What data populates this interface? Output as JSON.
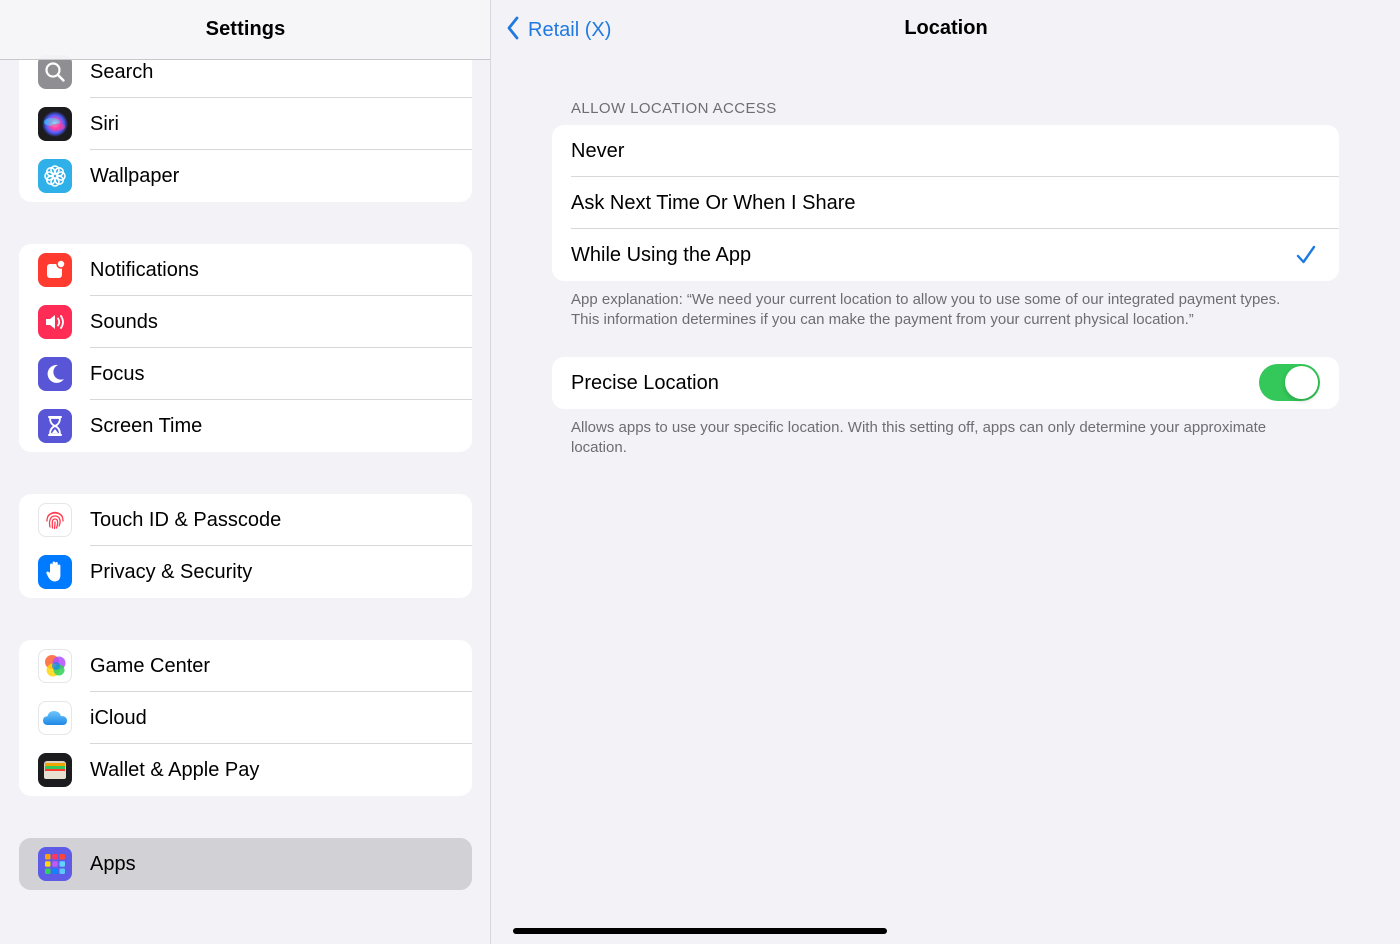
{
  "sidebar": {
    "title": "Settings",
    "groups": [
      {
        "items": [
          {
            "label": "Search",
            "icon": "search-icon",
            "color": "#8e8e93"
          },
          {
            "label": "Siri",
            "icon": "siri-icon",
            "color": "#1c1c1e"
          },
          {
            "label": "Wallpaper",
            "icon": "wallpaper-icon",
            "color": "#30b0e8"
          }
        ]
      },
      {
        "items": [
          {
            "label": "Notifications",
            "icon": "notifications-icon",
            "color": "#ff3b30"
          },
          {
            "label": "Sounds",
            "icon": "sounds-icon",
            "color": "#ff2d55"
          },
          {
            "label": "Focus",
            "icon": "focus-icon",
            "color": "#5856d6"
          },
          {
            "label": "Screen Time",
            "icon": "screen-time-icon",
            "color": "#5856d6"
          }
        ]
      },
      {
        "items": [
          {
            "label": "Touch ID & Passcode",
            "icon": "touch-id-icon",
            "color": "#ffffff"
          },
          {
            "label": "Privacy & Security",
            "icon": "privacy-icon",
            "color": "#007aff"
          }
        ]
      },
      {
        "items": [
          {
            "label": "Game Center",
            "icon": "game-center-icon",
            "color": "#ffffff"
          },
          {
            "label": "iCloud",
            "icon": "icloud-icon",
            "color": "#ffffff"
          },
          {
            "label": "Wallet & Apple Pay",
            "icon": "wallet-icon",
            "color": "#1c1c1e"
          }
        ]
      },
      {
        "items": [
          {
            "label": "Apps",
            "icon": "apps-icon",
            "color": "#5e5ce6",
            "selected": true
          }
        ]
      }
    ]
  },
  "detail": {
    "back_label": "Retail (X)",
    "title": "Location",
    "section_header": "ALLOW LOCATION ACCESS",
    "options": [
      {
        "label": "Never",
        "checked": false
      },
      {
        "label": "Ask Next Time Or When I Share",
        "checked": false
      },
      {
        "label": "While Using the App",
        "checked": true
      }
    ],
    "app_explanation": "App explanation: “We need your current location to allow you to use some of our integrated payment types. This information determines if you can make the payment from your current physical location.”",
    "precise_location": {
      "label": "Precise Location",
      "enabled": true,
      "footnote": "Allows apps to use your specific location. With this setting off, apps can only determine your approximate location."
    }
  },
  "colors": {
    "accent": "#1f7ae0",
    "toggle_on": "#34c759",
    "background": "#f2f2f7"
  }
}
